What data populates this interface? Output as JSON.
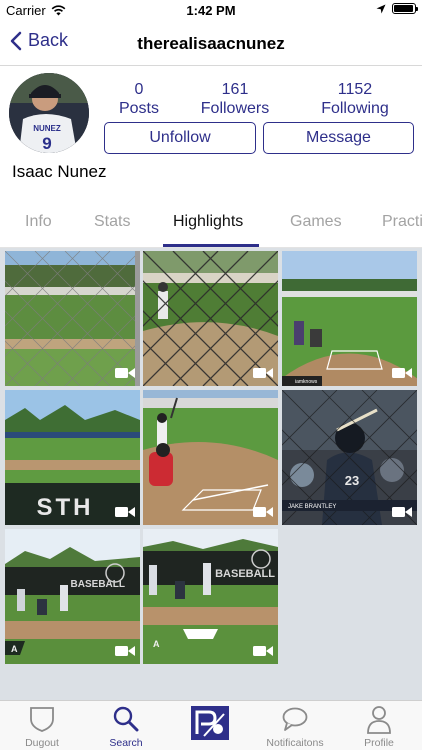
{
  "status_bar": {
    "carrier": "Carrier",
    "time": "1:42 PM",
    "battery_level": 0.95
  },
  "nav": {
    "back_label": "Back",
    "title": "therealisaacnunez"
  },
  "profile": {
    "name": "Isaac Nunez",
    "jersey_name": "NUNEZ",
    "jersey_number": "9",
    "stats": [
      {
        "value": "0",
        "label": "Posts"
      },
      {
        "value": "161",
        "label": "Followers"
      },
      {
        "value": "1152",
        "label": "Following"
      }
    ],
    "unfollow_label": "Unfollow",
    "message_label": "Message"
  },
  "tabs": [
    {
      "label": "Info",
      "active": false
    },
    {
      "label": "Stats",
      "active": false
    },
    {
      "label": "Highlights",
      "active": true
    },
    {
      "label": "Games",
      "active": false
    },
    {
      "label": "Practice",
      "active": false
    }
  ],
  "highlights": {
    "items": [
      {
        "kind": "video",
        "scene": "fence-field"
      },
      {
        "kind": "video",
        "scene": "fence-batter"
      },
      {
        "kind": "video",
        "scene": "home-plate"
      },
      {
        "kind": "video",
        "scene": "stadium-wall"
      },
      {
        "kind": "video",
        "scene": "batter-catcher"
      },
      {
        "kind": "video",
        "scene": "closeup-batter"
      },
      {
        "kind": "video",
        "scene": "batting-cage"
      },
      {
        "kind": "video",
        "scene": "batting-cage-2"
      }
    ],
    "watermarks": {
      "item_3": "iamknows",
      "item_6": "JAKE BRANTLEY"
    },
    "signage": "BASEBALL"
  },
  "bottom_tabs": [
    {
      "label": "Dugout",
      "icon": "shield-icon",
      "active": false
    },
    {
      "label": "Search",
      "icon": "search-icon",
      "active": true
    },
    {
      "label": "",
      "icon": "app-logo-icon",
      "active": false
    },
    {
      "label": "Notificaitons",
      "icon": "chat-bubble-icon",
      "active": false
    },
    {
      "label": "Profile",
      "icon": "person-icon",
      "active": false
    }
  ],
  "colors": {
    "accent": "#2e2f8a",
    "inactive": "#a3a3a3",
    "grid_bg": "#dbe0e5"
  }
}
